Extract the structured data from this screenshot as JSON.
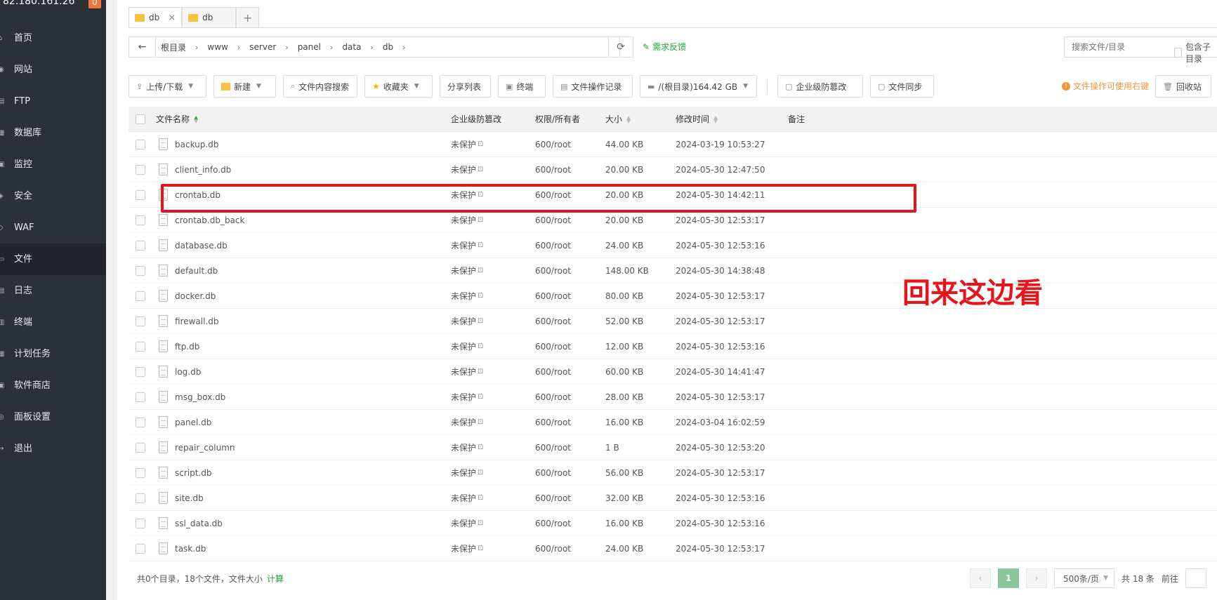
{
  "sidebar": {
    "server_ip": "82.180.161.26",
    "badge": "0",
    "items": [
      {
        "label": "首页"
      },
      {
        "label": "网站"
      },
      {
        "label": "FTP"
      },
      {
        "label": "数据库"
      },
      {
        "label": "监控"
      },
      {
        "label": "安全"
      },
      {
        "label": "WAF"
      },
      {
        "label": "文件"
      },
      {
        "label": "日志"
      },
      {
        "label": "终端"
      },
      {
        "label": "计划任务"
      },
      {
        "label": "软件商店"
      },
      {
        "label": "面板设置"
      },
      {
        "label": "退出"
      }
    ],
    "active_item": "文件"
  },
  "tabs": [
    {
      "label": "db",
      "close": "×"
    },
    {
      "label": "db"
    }
  ],
  "tab_add": "+",
  "path": {
    "back": "←",
    "crumbs": [
      "根目录",
      "www",
      "server",
      "panel",
      "data",
      "db"
    ],
    "sep": "›",
    "refresh": "⟳"
  },
  "feedback": "需求反馈",
  "search": {
    "placeholder": "搜索文件/目录"
  },
  "subdir_label": "包含子目录",
  "toolbar": {
    "upload": "上传/下载",
    "new": "新建",
    "content_search": "文件内容搜索",
    "favorites": "收藏夹",
    "share_list": "分享列表",
    "terminal": "终端",
    "op_log": "文件操作记录",
    "disk": "/(根目录)164.42 GB",
    "tamper": "企业级防篡改",
    "sync": "文件同步",
    "tip": "文件操作可使用右键",
    "recycle": "回收站"
  },
  "table": {
    "headers": {
      "name": "文件名称",
      "protect": "企业级防篡改",
      "perm": "权限/所有者",
      "size": "大小",
      "mtime": "修改时间",
      "note": "备注"
    },
    "rows": [
      {
        "name": "backup.db",
        "protect": "未保护",
        "perm": "600/root",
        "size": "44.00 KB",
        "mtime": "2024-03-19 10:53:27"
      },
      {
        "name": "client_info.db",
        "protect": "未保护",
        "perm": "600/root",
        "size": "20.00 KB",
        "mtime": "2024-05-30 12:47:50"
      },
      {
        "name": "crontab.db",
        "protect": "未保护",
        "perm": "600/root",
        "size": "20.00 KB",
        "mtime": "2024-05-30 14:42:11"
      },
      {
        "name": "crontab.db_back",
        "protect": "未保护",
        "perm": "600/root",
        "size": "20.00 KB",
        "mtime": "2024-05-30 12:53:17"
      },
      {
        "name": "database.db",
        "protect": "未保护",
        "perm": "600/root",
        "size": "24.00 KB",
        "mtime": "2024-05-30 12:53:16"
      },
      {
        "name": "default.db",
        "protect": "未保护",
        "perm": "600/root",
        "size": "148.00 KB",
        "mtime": "2024-05-30 14:38:48"
      },
      {
        "name": "docker.db",
        "protect": "未保护",
        "perm": "600/root",
        "size": "80.00 KB",
        "mtime": "2024-05-30 12:53:17"
      },
      {
        "name": "firewall.db",
        "protect": "未保护",
        "perm": "600/root",
        "size": "52.00 KB",
        "mtime": "2024-05-30 12:53:17"
      },
      {
        "name": "ftp.db",
        "protect": "未保护",
        "perm": "600/root",
        "size": "12.00 KB",
        "mtime": "2024-05-30 12:53:16"
      },
      {
        "name": "log.db",
        "protect": "未保护",
        "perm": "600/root",
        "size": "60.00 KB",
        "mtime": "2024-05-30 14:41:47"
      },
      {
        "name": "msg_box.db",
        "protect": "未保护",
        "perm": "600/root",
        "size": "28.00 KB",
        "mtime": "2024-05-30 12:53:17"
      },
      {
        "name": "panel.db",
        "protect": "未保护",
        "perm": "600/root",
        "size": "16.00 KB",
        "mtime": "2024-03-04 16:02:59"
      },
      {
        "name": "repair_column",
        "protect": "未保护",
        "perm": "600/root",
        "size": "1 B",
        "mtime": "2024-05-30 12:53:20"
      },
      {
        "name": "script.db",
        "protect": "未保护",
        "perm": "600/root",
        "size": "56.00 KB",
        "mtime": "2024-05-30 12:53:17"
      },
      {
        "name": "site.db",
        "protect": "未保护",
        "perm": "600/root",
        "size": "32.00 KB",
        "mtime": "2024-05-30 12:53:16"
      },
      {
        "name": "ssl_data.db",
        "protect": "未保护",
        "perm": "600/root",
        "size": "16.00 KB",
        "mtime": "2024-05-30 12:53:16"
      },
      {
        "name": "task.db",
        "protect": "未保护",
        "perm": "600/root",
        "size": "24.00 KB",
        "mtime": "2024-05-30 12:53:17"
      }
    ]
  },
  "annotation": "回来这边看",
  "footer": {
    "summary": "共0个目录，18个文件，文件大小",
    "calc": "计算",
    "prev": "‹",
    "current_page": "1",
    "next": "›",
    "per_page": "500条/页",
    "total": "共 18 条",
    "goto": "前往"
  },
  "colors": {
    "accent": "#20a53a",
    "highlight": "#e8141b",
    "sidebar": "#2c3138"
  }
}
